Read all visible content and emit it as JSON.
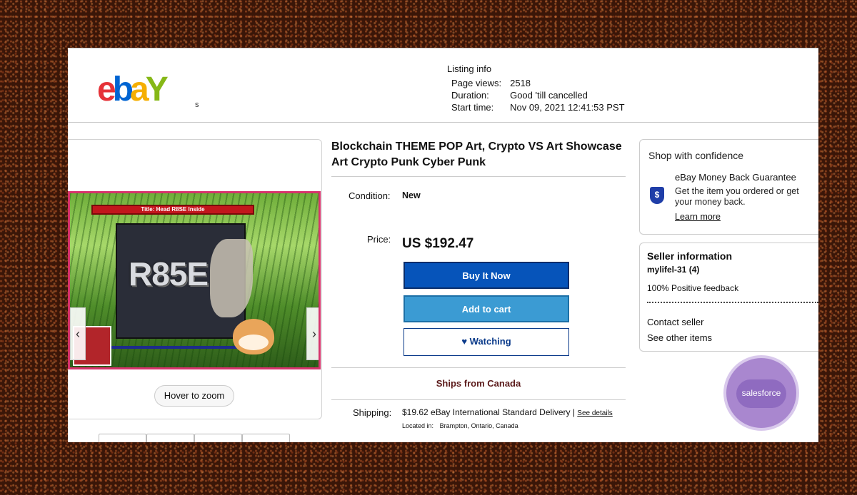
{
  "logo": {
    "e": "e",
    "b": "b",
    "a": "a",
    "y": "Y",
    "suffix": "s"
  },
  "listing_info": {
    "title": "Listing info",
    "rows": [
      {
        "label": "Page views:",
        "value": "2518"
      },
      {
        "label": "Duration:",
        "value": "Good 'till cancelled"
      },
      {
        "label": "Start time:",
        "value": "Nov 09, 2021 12:41:53 PST"
      }
    ]
  },
  "gallery": {
    "banner": "Title: Head R8SE Inside",
    "image_text": "R85E",
    "prev_icon": "‹",
    "next_icon": "›",
    "zoom_label": "Hover to zoom"
  },
  "product": {
    "title": "Blockchain THEME POP Art, Crypto VS Art Showcase Art Crypto Punk Cyber Punk",
    "condition_label": "Condition:",
    "condition_value": "New",
    "price_label": "Price:",
    "price_value": "US $192.47",
    "buy_label": "Buy It Now",
    "cart_label": "Add to cart",
    "watch_icon": "♥",
    "watch_label": "Watching",
    "ships_from": "Ships from Canada",
    "shipping_label": "Shipping:",
    "shipping_cost": "$19.62",
    "shipping_method": "eBay International Standard Delivery |",
    "shipping_details_link": "See details",
    "located_label": "Located in:",
    "located_value": "Brampton, Ontario, Canada"
  },
  "confidence": {
    "title": "Shop with confidence",
    "icon": "$",
    "guarantee": "eBay Money Back Guarantee",
    "description": "Get the item you ordered or get your money back.",
    "learn_more": "Learn more"
  },
  "seller": {
    "title": "Seller information",
    "name": "mylifel-31 (4)",
    "feedback": "100% Positive feedback",
    "contact": "Contact seller",
    "other_items": "See other items"
  },
  "badge": {
    "text": "salesforce"
  }
}
